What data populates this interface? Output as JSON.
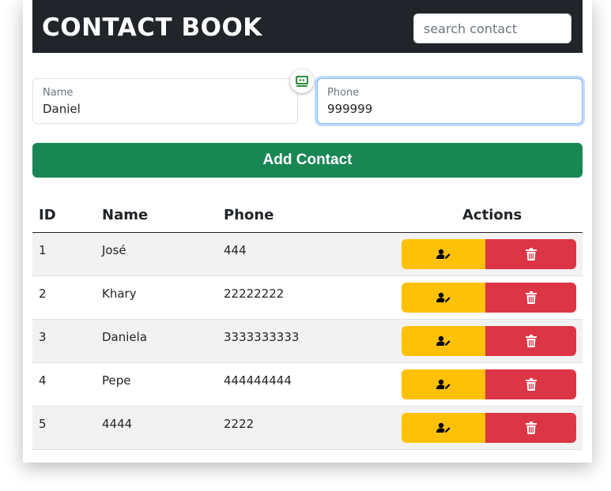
{
  "header": {
    "title": "CONTACT BOOK",
    "search_placeholder": "search contact"
  },
  "form": {
    "name_label": "Name",
    "name_value": "Daniel",
    "phone_label": "Phone",
    "phone_value": "999999",
    "add_label": "Add Contact"
  },
  "table": {
    "headers": {
      "id": "ID",
      "name": "Name",
      "phone": "Phone",
      "actions": "Actions"
    },
    "rows": [
      {
        "id": "1",
        "name": "José",
        "phone": "444"
      },
      {
        "id": "2",
        "name": "Khary",
        "phone": "22222222"
      },
      {
        "id": "3",
        "name": "Daniela",
        "phone": "3333333333"
      },
      {
        "id": "4",
        "name": "Pepe",
        "phone": "444444444"
      },
      {
        "id": "5",
        "name": "4444",
        "phone": "2222"
      }
    ]
  },
  "icons": {
    "edit": "user-edit-icon",
    "delete": "trash-icon",
    "extension": "password-manager-icon"
  },
  "colors": {
    "header": "#212529",
    "add": "#198754",
    "edit": "#ffc107",
    "delete": "#dc3545"
  }
}
